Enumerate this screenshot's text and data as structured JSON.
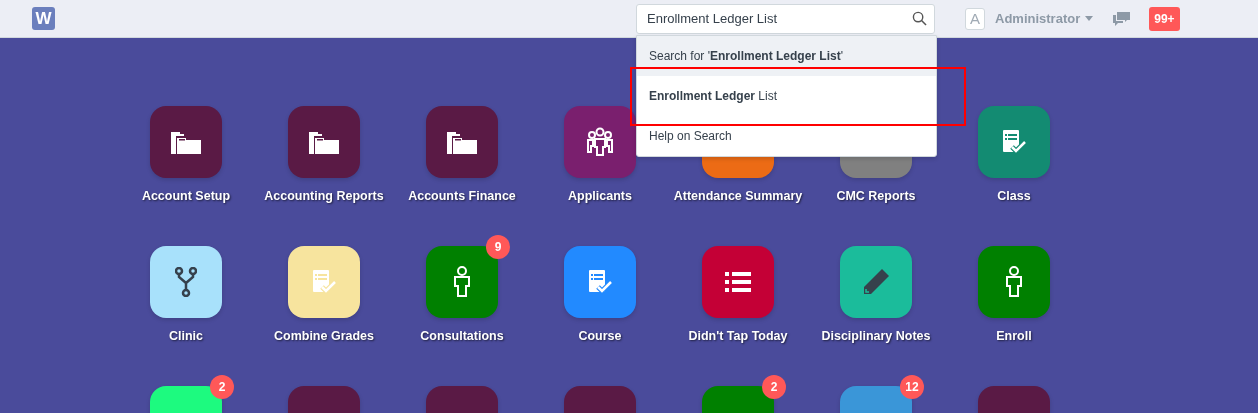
{
  "navbar": {
    "logo": "W",
    "search": {
      "value": "Enrollment Ledger List"
    },
    "avatar": "A",
    "user": "Administrator",
    "notifications": "99+"
  },
  "search_dropdown": {
    "items": [
      {
        "text": "Search for '**Enrollment Ledger List**'",
        "selected": true
      },
      {
        "text": "**Enrollment Ledger** List",
        "selected": false
      },
      {
        "text": "Help on Search",
        "selected": false
      }
    ],
    "highlight_box": true
  },
  "modules": [
    {
      "label": "Account Setup",
      "color": "#5a1a45",
      "kind": "folder"
    },
    {
      "label": "Accounting Reports",
      "color": "#5a1a45",
      "kind": "folder"
    },
    {
      "label": "Accounts Finance",
      "color": "#5a1a45",
      "kind": "folder"
    },
    {
      "label": "Applicants",
      "color": "#7a1f6e",
      "kind": "group"
    },
    {
      "label": "Attendance Summary",
      "color": "#ec6b15",
      "kind": "blank"
    },
    {
      "label": "CMC Reports",
      "color": "#808080",
      "kind": "blank"
    },
    {
      "label": "Class",
      "color": "#138b72",
      "kind": "checklist"
    },
    {
      "label": "Clinic",
      "color": "#a8e1fb",
      "kind": "fork"
    },
    {
      "label": "Combine Grades",
      "color": "#f7e49e",
      "kind": "checklist"
    },
    {
      "label": "Consultations",
      "color": "#008000",
      "kind": "person",
      "badge": "9"
    },
    {
      "label": "Course",
      "color": "#228aff",
      "kind": "checklist"
    },
    {
      "label": "Didn't Tap Today",
      "color": "#c40036",
      "kind": "list"
    },
    {
      "label": "Disciplinary Notes",
      "color": "#1bbc9b",
      "kind": "pencil"
    },
    {
      "label": "Enroll",
      "color": "#008000",
      "kind": "person"
    },
    {
      "color": "#1dfa7f",
      "kind": "blank",
      "badge": "2"
    },
    {
      "color": "#5a1a45",
      "kind": "blank"
    },
    {
      "color": "#5a1a45",
      "kind": "blank"
    },
    {
      "color": "#5a1a45",
      "kind": "blank"
    },
    {
      "color": "#008000",
      "kind": "blank",
      "badge": "2"
    },
    {
      "color": "#3a96d8",
      "kind": "blank",
      "badge": "12"
    },
    {
      "color": "#5a1a45",
      "kind": "blank"
    }
  ]
}
